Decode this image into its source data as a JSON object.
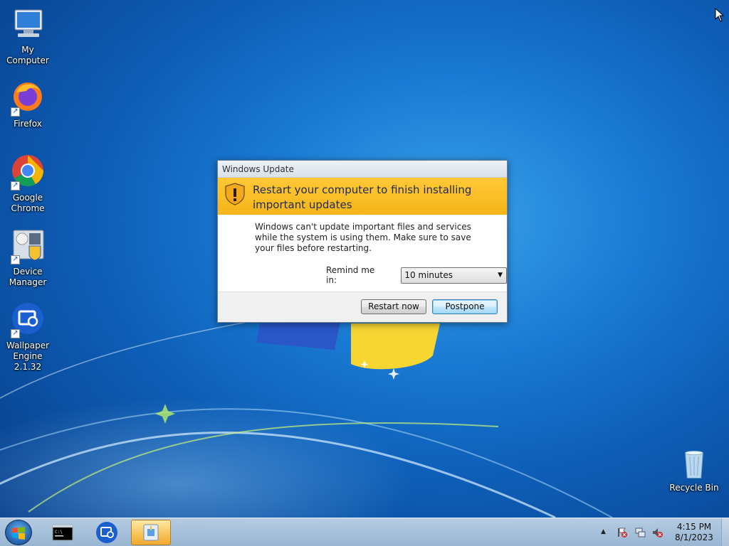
{
  "desktop": {
    "icons": [
      {
        "label": "My Computer",
        "icon": "computer-icon"
      },
      {
        "label": "Firefox",
        "icon": "firefox-icon"
      },
      {
        "label": "Google Chrome",
        "icon": "chrome-icon"
      },
      {
        "label": "Device Manager",
        "icon": "device-manager-icon"
      },
      {
        "label": "Wallpaper Engine 2.1.32",
        "icon": "wallpaper-engine-icon"
      },
      {
        "label": "Recycle Bin",
        "icon": "recycle-bin-icon"
      }
    ]
  },
  "dialog": {
    "title": "Windows Update",
    "heading": "Restart your computer to finish installing important updates",
    "body": "Windows can't update important files and services while the system is using them. Make sure to save your files before restarting.",
    "remind_label": "Remind me in:",
    "remind_value": "10 minutes",
    "buttons": {
      "restart": "Restart now",
      "postpone": "Postpone"
    }
  },
  "taskbar": {
    "items": [
      "start-orb",
      "command-prompt",
      "wallpaper-engine",
      "windows-update"
    ],
    "clock": {
      "time": "4:15 PM",
      "date": "8/1/2023"
    }
  },
  "colors": {
    "banner": "#f5b419",
    "heading": "#1d2a55",
    "desktop": "#1a7bd4"
  }
}
